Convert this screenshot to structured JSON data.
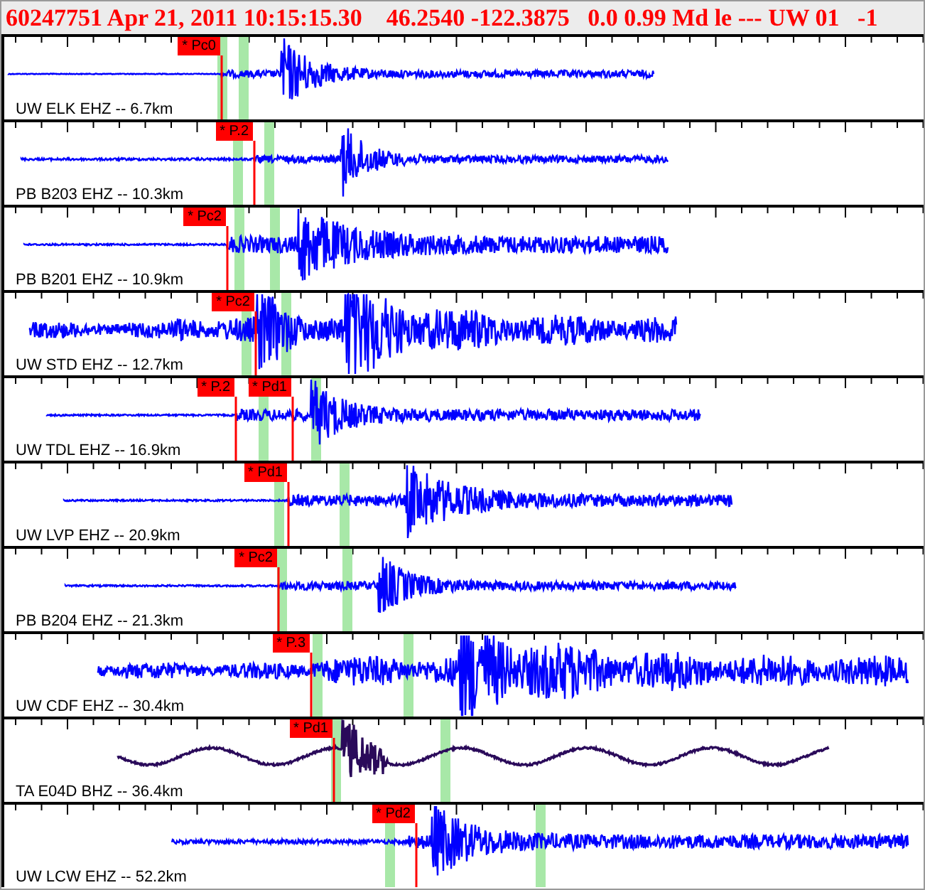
{
  "header": "60247751 Apr 21, 2011 10:15:15.30    46.2540 -122.3875   0.0 0.99 Md le --- UW 01   -1",
  "traces": [
    {
      "label": "UW ELK EHZ -- 6.7km",
      "color": "#0000ff",
      "picks": [
        {
          "label": "* Pc0"
        }
      ]
    },
    {
      "label": "PB B203 EHZ -- 10.3km",
      "color": "#0000ff",
      "picks": [
        {
          "label": "* P.2"
        }
      ]
    },
    {
      "label": "PB B201 EHZ -- 10.9km",
      "color": "#0000ff",
      "picks": [
        {
          "label": "* Pc2"
        }
      ]
    },
    {
      "label": "UW STD EHZ -- 12.7km",
      "color": "#0000ff",
      "picks": [
        {
          "label": "* Pc2"
        }
      ]
    },
    {
      "label": "UW TDL EHZ -- 16.9km",
      "color": "#0000ff",
      "picks": [
        {
          "label": "* P.2"
        },
        {
          "label": "* Pd1"
        }
      ]
    },
    {
      "label": "UW LVP EHZ -- 20.9km",
      "color": "#0000ff",
      "picks": [
        {
          "label": "* Pd1"
        }
      ]
    },
    {
      "label": "PB B204 EHZ -- 21.3km",
      "color": "#0000ff",
      "picks": [
        {
          "label": "* Pc2"
        }
      ]
    },
    {
      "label": "UW CDF EHZ -- 30.4km",
      "color": "#0000ff",
      "picks": [
        {
          "label": "* P.3"
        }
      ]
    },
    {
      "label": "TA E04D BHZ -- 36.4km",
      "color": "#2a0a5a",
      "picks": [
        {
          "label": "* Pd1"
        }
      ]
    },
    {
      "label": "UW LCW EHZ -- 52.2km",
      "color": "#0000ff",
      "picks": [
        {
          "label": "* Pd2"
        }
      ]
    }
  ]
}
